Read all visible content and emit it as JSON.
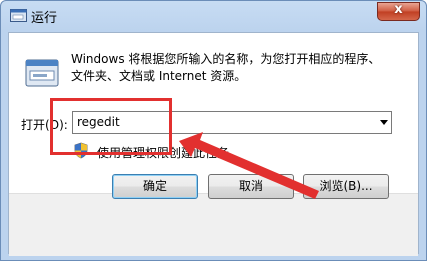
{
  "window": {
    "title": "运行",
    "title_icon": "run-icon",
    "close_icon": "close-icon",
    "close_glyph": "x"
  },
  "content": {
    "description_line1": "Windows 将根据您所输入的名称，为您打开相应的程序、",
    "description_line2": "文件夹、文档或 Internet 资源。",
    "open_label": "打开(O):",
    "input_value": "regedit",
    "admin_icon": "shield-icon",
    "admin_text": "使用管理权限创建此任务。"
  },
  "buttons": {
    "ok": "确定",
    "cancel": "取消",
    "browse": "浏览(B)..."
  },
  "annotation": {
    "color": "#e2302f"
  }
}
